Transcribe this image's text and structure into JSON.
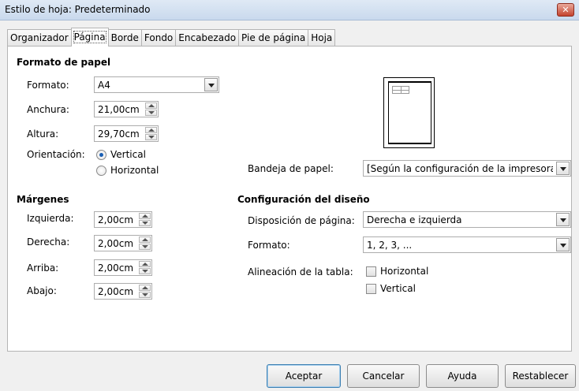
{
  "window": {
    "title": "Estilo de hoja: Predeterminado",
    "close_glyph": "✕"
  },
  "tabs": [
    {
      "label": "Organizador"
    },
    {
      "label": "Página"
    },
    {
      "label": "Borde"
    },
    {
      "label": "Fondo"
    },
    {
      "label": "Encabezado"
    },
    {
      "label": "Pie de página"
    },
    {
      "label": "Hoja"
    }
  ],
  "paper_format": {
    "header": "Formato de papel",
    "format_label": "Formato:",
    "format_value": "A4",
    "width_label": "Anchura:",
    "width_value": "21,00cm",
    "height_label": "Altura:",
    "height_value": "29,70cm",
    "orientation_label": "Orientación:",
    "portrait_label": "Vertical",
    "landscape_label": "Horizontal"
  },
  "paper_tray": {
    "label": "Bandeja de papel:",
    "value": "[Según la configuración de la impresora]"
  },
  "margins": {
    "header": "Márgenes",
    "left_label": "Izquierda:",
    "left_value": "2,00cm",
    "right_label": "Derecha:",
    "right_value": "2,00cm",
    "top_label": "Arriba:",
    "top_value": "2,00cm",
    "bottom_label": "Abajo:",
    "bottom_value": "2,00cm"
  },
  "layout": {
    "header": "Configuración del diseño",
    "page_layout_label": "Disposición de página:",
    "page_layout_value": "Derecha e izquierda",
    "format_label": "Formato:",
    "format_value": "1, 2, 3, ...",
    "table_align_label": "Alineación de la tabla:",
    "horizontal_label": "Horizontal",
    "vertical_label": "Vertical"
  },
  "buttons": {
    "ok": "Aceptar",
    "cancel": "Cancelar",
    "help": "Ayuda",
    "reset": "Restablecer"
  }
}
